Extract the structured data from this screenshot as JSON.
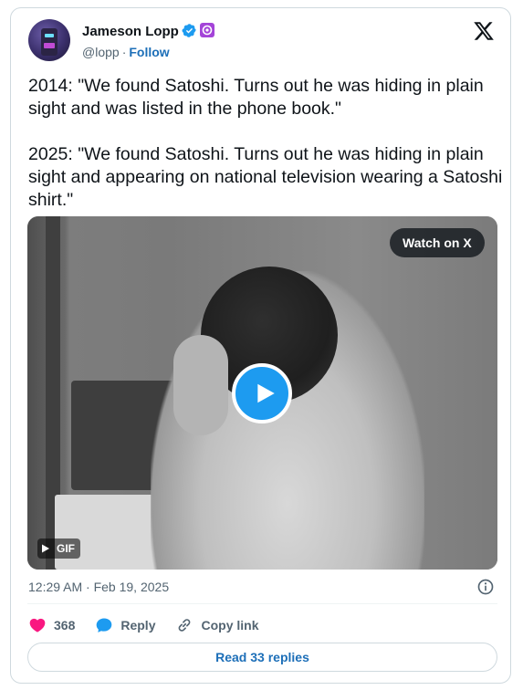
{
  "author": {
    "name": "Jameson Lopp",
    "handle": "@lopp",
    "separator": "·",
    "follow_label": "Follow"
  },
  "tweet": {
    "text": "2014: \"We found Satoshi. Turns out he was hiding in plain sight and was listed in the phone book.\"\n\n2025: \"We found Satoshi. Turns out he was hiding in plain sight and appearing on national television wearing a Satoshi shirt.\""
  },
  "media": {
    "watch_label": "Watch on X",
    "badge_label": "GIF"
  },
  "meta": {
    "timestamp": "12:29 AM · Feb 19, 2025"
  },
  "actions": {
    "like_count": "368",
    "reply_label": "Reply",
    "copy_label": "Copy link"
  },
  "footer": {
    "read_replies_label": "Read 33 replies"
  },
  "colors": {
    "accent": "#1d9bf0",
    "like": "#f91880",
    "link": "#1d6fb8",
    "muted": "#536471",
    "affiliate_badge": "#a444d8"
  },
  "icons": {
    "verified": "verified-badge-icon",
    "affiliate": "affiliate-badge-icon",
    "logo": "x-logo-icon",
    "play": "play-icon",
    "info": "info-icon",
    "like": "heart-icon",
    "reply": "speech-bubble-icon",
    "copy": "link-icon"
  }
}
